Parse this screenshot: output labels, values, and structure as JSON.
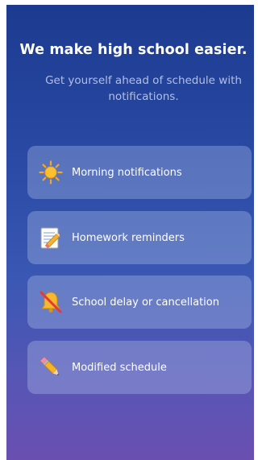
{
  "header": {
    "title": "We make high school easier.",
    "subtitle": "Get yourself ahead of schedule with notifications."
  },
  "options": [
    {
      "label": "Morning notifications",
      "icon": "sun-icon"
    },
    {
      "label": "Homework reminders",
      "icon": "memo-icon"
    },
    {
      "label": "School delay or cancellation",
      "icon": "bell-off-icon"
    },
    {
      "label": "Modified schedule",
      "icon": "pencil-icon"
    }
  ],
  "colors": {
    "background_top": "#1c3a8f",
    "background_bottom": "#6a4fb0",
    "card": "#bccdf0",
    "text": "#ffffff"
  }
}
